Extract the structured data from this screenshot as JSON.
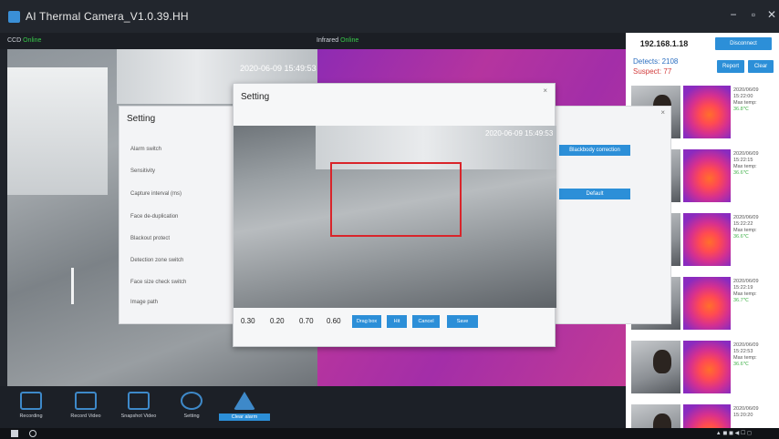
{
  "window": {
    "title": "AI Thermal Camera_V1.0.39.HH",
    "minimize": "−",
    "maximize": "▫",
    "close": "✕"
  },
  "cameras": {
    "ccd_label": "CCD",
    "ccd_status": "Online",
    "ir_label": "Infrared",
    "ir_status": "Online",
    "timestamp": "2020-06-09 15:49:53"
  },
  "toolbar": {
    "items": [
      {
        "label": "Recording",
        "icon": "camera-icon"
      },
      {
        "label": "Record Video",
        "icon": "folder-icon"
      },
      {
        "label": "Snapshot Video",
        "icon": "folder-icon"
      },
      {
        "label": "Setting",
        "icon": "gear-icon"
      },
      {
        "label": "Clear alarm",
        "icon": "alert-icon"
      }
    ]
  },
  "side": {
    "ip": "192.168.1.18",
    "disconnect": "Disconnect",
    "detects_label": "Detects:",
    "detects_value": "2108",
    "suspect_label": "Suspect:",
    "suspect_value": "77",
    "report": "Report",
    "clear": "Clear",
    "records": [
      {
        "date": "2020/06/09",
        "time": "15:22:00",
        "label": "Max temp:",
        "temp": "36.8℃"
      },
      {
        "date": "2020/06/09",
        "time": "15:22:15",
        "label": "Max temp:",
        "temp": "36.6℃"
      },
      {
        "date": "2020/06/09",
        "time": "15:22:22",
        "label": "Max temp:",
        "temp": "36.6℃"
      },
      {
        "date": "2020/06/09",
        "time": "15:22:19",
        "label": "Max temp:",
        "temp": "36.7℃"
      },
      {
        "date": "2020/06/09",
        "time": "15:22:53",
        "label": "Max temp:",
        "temp": "36.6℃"
      },
      {
        "date": "2020/06/09",
        "time": "15:20:20",
        "label": "",
        "temp": ""
      }
    ]
  },
  "setting_back": {
    "title": "Setting",
    "labels": [
      "Alarm switch",
      "Sensitivity",
      "Capture interval (ms)",
      "Face de-duplication",
      "Blackout protect",
      "Detection zone switch",
      "Face size check switch",
      "Image path"
    ],
    "btn_correction": "Blackbody correction",
    "btn_default": "Default"
  },
  "setting_front": {
    "title": "Setting",
    "timestamp": "2020-06-09 15:49:53",
    "values": [
      "0.30",
      "0.20",
      "0.70",
      "0.60"
    ],
    "buttons": [
      "Drag box",
      "Hit",
      "Cancel",
      "Save"
    ]
  }
}
